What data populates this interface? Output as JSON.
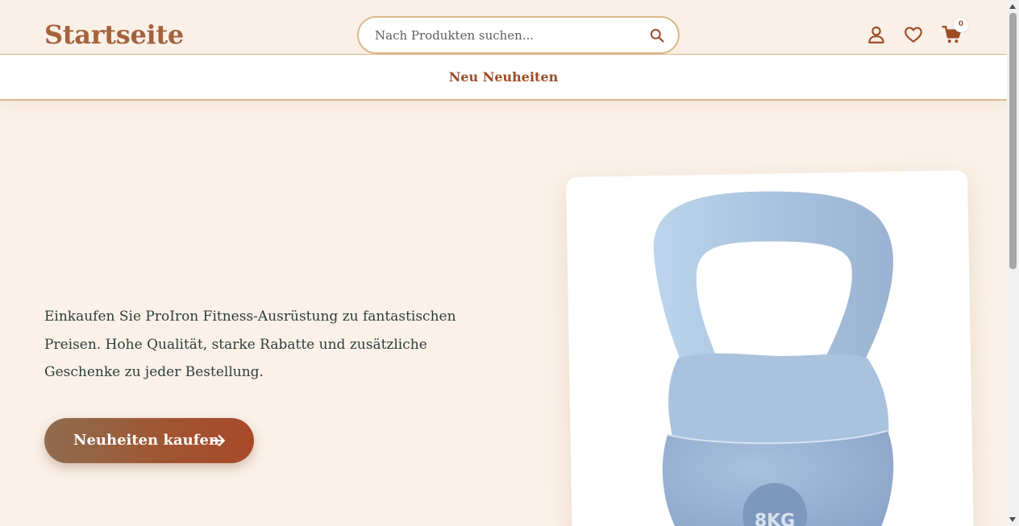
{
  "header": {
    "logo": "Startseite",
    "search": {
      "placeholder": "Nach Produkten suchen...",
      "value": ""
    },
    "icons": [
      "user-icon",
      "heart-icon",
      "cart-icon"
    ],
    "cart_count": "0"
  },
  "nav": {
    "link": "Neu Neuheiten"
  },
  "hero": {
    "text": "Einkaufen Sie ProIron Fitness-Ausrüstung zu fantastischen Preisen. Hohe Qualität, starke Rabatte und zusätzliche Geschenke zu jeder Bestellung.",
    "cta_label": "Neuheiten kaufen",
    "image_text": "8KG"
  },
  "colors": {
    "background": "#fbf1e8",
    "brand": "#a4623d",
    "accent": "#9c4d27",
    "border": "#d9b98c",
    "text": "#2c3e3a"
  }
}
